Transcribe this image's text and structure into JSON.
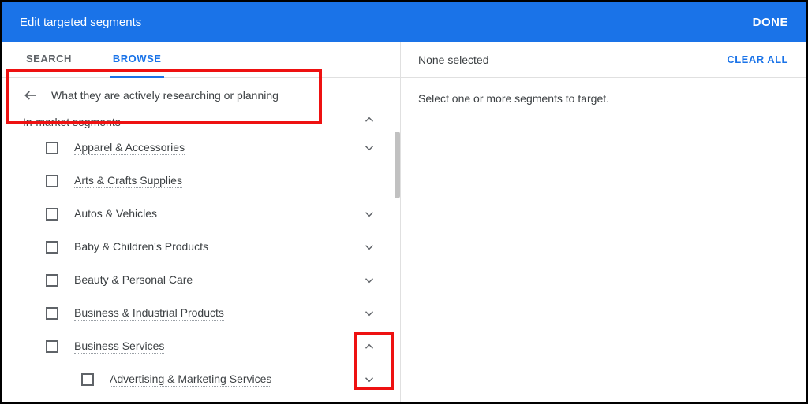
{
  "header": {
    "title": "Edit targeted segments",
    "done": "DONE"
  },
  "tabs": {
    "search": "SEARCH",
    "browse": "BROWSE"
  },
  "breadcrumb": "What they are actively researching or planning",
  "section": "In-market segments",
  "items": [
    {
      "label": "Apparel & Accessories",
      "expand": "down"
    },
    {
      "label": "Arts & Crafts Supplies",
      "expand": ""
    },
    {
      "label": "Autos & Vehicles",
      "expand": "down"
    },
    {
      "label": "Baby & Children's Products",
      "expand": "down"
    },
    {
      "label": "Beauty & Personal Care",
      "expand": "down"
    },
    {
      "label": "Business & Industrial Products",
      "expand": "down"
    },
    {
      "label": "Business Services",
      "expand": "up"
    }
  ],
  "child_item": {
    "label": "Advertising & Marketing Services",
    "expand": "down"
  },
  "right": {
    "none": "None selected",
    "clear": "CLEAR ALL",
    "hint": "Select one or more segments to target."
  }
}
